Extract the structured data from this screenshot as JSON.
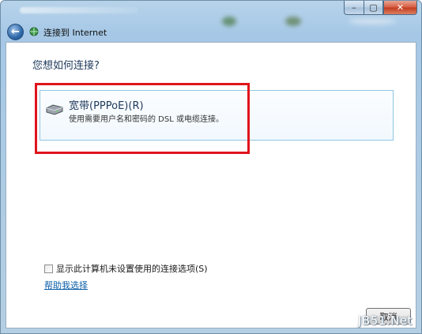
{
  "window": {
    "nav_title": "连接到 Internet",
    "icons": {
      "back": "back-arrow-icon",
      "network": "network-icon",
      "minimize": "minimize-icon",
      "maximize": "maximize-icon",
      "close": "close-icon"
    }
  },
  "main": {
    "question": "您想如何连接?",
    "option": {
      "title": "宽带(PPPoE)(R)",
      "description": "使用需要用户名和密码的 DSL 或电缆连接。",
      "icon": "broadband-modem-icon"
    },
    "show_options_checkbox": {
      "label": "显示此计算机未设置使用的连接选项(S)",
      "checked": false
    },
    "help_link": "帮助我选择",
    "cancel_button": "取消"
  },
  "watermark": "JB51.Net",
  "colors": {
    "highlight_border": "#e0141c",
    "link": "#0b5ea8",
    "heading": "#1e395b"
  }
}
